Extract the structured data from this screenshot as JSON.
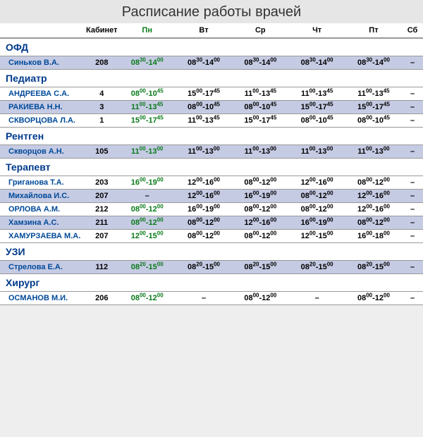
{
  "title": "Расписание работы врачей",
  "headers": {
    "name": "",
    "cab": "Кабинет",
    "days": [
      "Пн",
      "Вт",
      "Ср",
      "Чт",
      "Пт",
      "Сб"
    ],
    "highlight_day_index": 0
  },
  "sections": [
    {
      "title": "ОФД",
      "doctors": [
        {
          "name": "Синьков В.А.",
          "cab": "208",
          "schedule": [
            {
              "s": "08",
              "sm": "30",
              "e": "14",
              "em": "00",
              "hl": true
            },
            {
              "s": "08",
              "sm": "30",
              "e": "14",
              "em": "00"
            },
            {
              "s": "08",
              "sm": "30",
              "e": "14",
              "em": "00"
            },
            {
              "s": "08",
              "sm": "30",
              "e": "14",
              "em": "00"
            },
            {
              "s": "08",
              "sm": "30",
              "e": "14",
              "em": "00"
            },
            null
          ]
        }
      ]
    },
    {
      "title": "Педиатр",
      "doctors": [
        {
          "name": "АНДРЕЕВА С.А.",
          "cab": "4",
          "schedule": [
            {
              "s": "08",
              "sm": "00",
              "e": "10",
              "em": "45",
              "hl": true
            },
            {
              "s": "15",
              "sm": "00",
              "e": "17",
              "em": "45"
            },
            {
              "s": "11",
              "sm": "00",
              "e": "13",
              "em": "45"
            },
            {
              "s": "11",
              "sm": "00",
              "e": "13",
              "em": "45"
            },
            {
              "s": "11",
              "sm": "00",
              "e": "13",
              "em": "45"
            },
            null
          ]
        },
        {
          "name": "РАКИЕВА Н.Н.",
          "cab": "3",
          "schedule": [
            {
              "s": "11",
              "sm": "00",
              "e": "13",
              "em": "45",
              "hl": true
            },
            {
              "s": "08",
              "sm": "00",
              "e": "10",
              "em": "45"
            },
            {
              "s": "08",
              "sm": "00",
              "e": "10",
              "em": "45"
            },
            {
              "s": "15",
              "sm": "00",
              "e": "17",
              "em": "45"
            },
            {
              "s": "15",
              "sm": "00",
              "e": "17",
              "em": "45"
            },
            null
          ]
        },
        {
          "name": "СКВОРЦОВА Л.А.",
          "cab": "1",
          "schedule": [
            {
              "s": "15",
              "sm": "00",
              "e": "17",
              "em": "45",
              "hl": true
            },
            {
              "s": "11",
              "sm": "00",
              "e": "13",
              "em": "45"
            },
            {
              "s": "15",
              "sm": "00",
              "e": "17",
              "em": "45"
            },
            {
              "s": "08",
              "sm": "00",
              "e": "10",
              "em": "45"
            },
            {
              "s": "08",
              "sm": "00",
              "e": "10",
              "em": "45"
            },
            null
          ]
        }
      ]
    },
    {
      "title": "Рентген",
      "doctors": [
        {
          "name": "Скворцов А.Н.",
          "cab": "105",
          "schedule": [
            {
              "s": "11",
              "sm": "00",
              "e": "13",
              "em": "00",
              "hl": true
            },
            {
              "s": "11",
              "sm": "00",
              "e": "13",
              "em": "00"
            },
            {
              "s": "11",
              "sm": "00",
              "e": "13",
              "em": "00"
            },
            {
              "s": "11",
              "sm": "00",
              "e": "13",
              "em": "00"
            },
            {
              "s": "11",
              "sm": "00",
              "e": "13",
              "em": "00"
            },
            null
          ]
        }
      ]
    },
    {
      "title": "Терапевт",
      "doctors": [
        {
          "name": "Григанова Т.А.",
          "cab": "203",
          "schedule": [
            {
              "s": "16",
              "sm": "00",
              "e": "19",
              "em": "00",
              "hl": true
            },
            {
              "s": "12",
              "sm": "00",
              "e": "16",
              "em": "00"
            },
            {
              "s": "08",
              "sm": "00",
              "e": "12",
              "em": "00"
            },
            {
              "s": "12",
              "sm": "00",
              "e": "16",
              "em": "00"
            },
            {
              "s": "08",
              "sm": "00",
              "e": "12",
              "em": "00"
            },
            null
          ]
        },
        {
          "name": "Михайлова И.С.",
          "cab": "207",
          "schedule": [
            null,
            {
              "s": "12",
              "sm": "00",
              "e": "16",
              "em": "00"
            },
            {
              "s": "16",
              "sm": "00",
              "e": "19",
              "em": "00"
            },
            {
              "s": "08",
              "sm": "00",
              "e": "12",
              "em": "00"
            },
            {
              "s": "12",
              "sm": "00",
              "e": "16",
              "em": "00"
            },
            null
          ]
        },
        {
          "name": "ОРЛОВА А.М.",
          "cab": "212",
          "schedule": [
            {
              "s": "08",
              "sm": "00",
              "e": "12",
              "em": "00",
              "hl": true
            },
            {
              "s": "16",
              "sm": "00",
              "e": "19",
              "em": "00"
            },
            {
              "s": "08",
              "sm": "00",
              "e": "12",
              "em": "00"
            },
            {
              "s": "08",
              "sm": "00",
              "e": "12",
              "em": "00"
            },
            {
              "s": "12",
              "sm": "00",
              "e": "16",
              "em": "00"
            },
            null
          ]
        },
        {
          "name": "Хамзина А.С.",
          "cab": "211",
          "schedule": [
            {
              "s": "08",
              "sm": "00",
              "e": "12",
              "em": "00",
              "hl": true
            },
            {
              "s": "08",
              "sm": "00",
              "e": "12",
              "em": "00"
            },
            {
              "s": "12",
              "sm": "00",
              "e": "16",
              "em": "00"
            },
            {
              "s": "16",
              "sm": "00",
              "e": "19",
              "em": "00"
            },
            {
              "s": "08",
              "sm": "00",
              "e": "12",
              "em": "00"
            },
            null
          ]
        },
        {
          "name": "ХАМУРЗАЕВА М.А.",
          "cab": "207",
          "schedule": [
            {
              "s": "12",
              "sm": "00",
              "e": "15",
              "em": "00",
              "hl": true
            },
            {
              "s": "08",
              "sm": "00",
              "e": "12",
              "em": "00"
            },
            {
              "s": "08",
              "sm": "00",
              "e": "12",
              "em": "00"
            },
            {
              "s": "12",
              "sm": "00",
              "e": "15",
              "em": "00"
            },
            {
              "s": "16",
              "sm": "00",
              "e": "18",
              "em": "00"
            },
            null
          ]
        }
      ]
    },
    {
      "title": "УЗИ",
      "doctors": [
        {
          "name": "Стрелова Е.А.",
          "cab": "112",
          "schedule": [
            {
              "s": "08",
              "sm": "20",
              "e": "15",
              "em": "00",
              "hl": true
            },
            {
              "s": "08",
              "sm": "20",
              "e": "15",
              "em": "00"
            },
            {
              "s": "08",
              "sm": "20",
              "e": "15",
              "em": "00"
            },
            {
              "s": "08",
              "sm": "20",
              "e": "15",
              "em": "00"
            },
            {
              "s": "08",
              "sm": "20",
              "e": "15",
              "em": "00"
            },
            null
          ]
        }
      ]
    },
    {
      "title": "Хирург",
      "doctors": [
        {
          "name": "ОСМАНОВ М.И.",
          "cab": "206",
          "schedule": [
            {
              "s": "08",
              "sm": "00",
              "e": "12",
              "em": "00",
              "hl": true
            },
            null,
            {
              "s": "08",
              "sm": "00",
              "e": "12",
              "em": "00"
            },
            null,
            {
              "s": "08",
              "sm": "00",
              "e": "12",
              "em": "00"
            },
            null
          ]
        }
      ]
    }
  ]
}
